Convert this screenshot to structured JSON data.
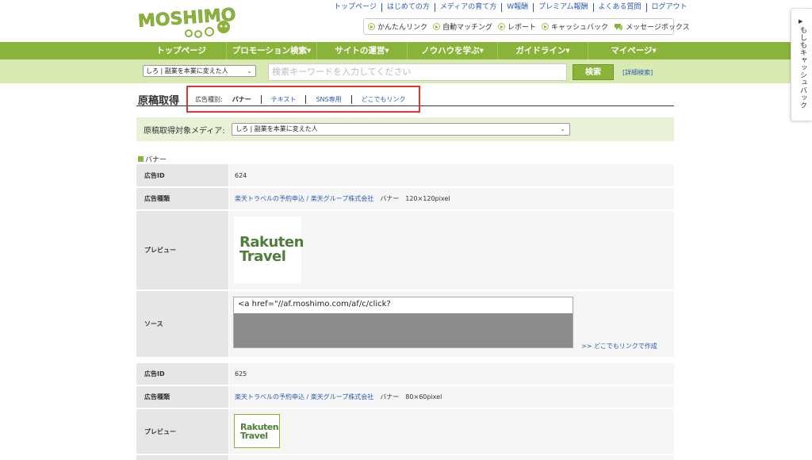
{
  "header": {
    "logo_text": "MOSHIMO",
    "top_links": [
      "トップページ",
      "はじめての方",
      "メディアの育て方",
      "W報酬",
      "プレミアム報酬",
      "よくある質問",
      "ログアウト"
    ],
    "quick_links": [
      "かんたんリンク",
      "自動マッチング",
      "レポート",
      "キャッシュバック",
      "メッセージボックス"
    ]
  },
  "nav": {
    "items": [
      "トップページ",
      "プロモーション検索▾",
      "サイトの運営▾",
      "ノウハウを学ぶ▾",
      "ガイドライン▾",
      "マイページ▾"
    ]
  },
  "search": {
    "media_select": "しろ | 副業を本業に変えた人",
    "placeholder": "検索キーワードを入力してください",
    "button": "検索",
    "advanced": "[詳細検索]"
  },
  "page": {
    "title": "原稿取得",
    "ad_type_label": "広告種別:",
    "tabs": [
      "バナー",
      "テキスト",
      "SNS専用",
      "どこでもリンク"
    ],
    "media_label": "原稿取得対象メディア:",
    "media_value": "しろ | 副業を本業に変えた人",
    "section": "バナー"
  },
  "labels": {
    "ad_id": "広告ID",
    "ad_type": "広告種類",
    "preview": "プレビュー",
    "source": "ソース"
  },
  "ads": [
    {
      "id": "624",
      "product_link": "楽天トラベルの予約申込 / 楽天グループ株式会社",
      "size_text": "バナー　120×120pixel",
      "preview_line1": "Rakuten",
      "preview_line2": "Travel",
      "source_text": "<a href=\"//af.moshimo.com/af/c/click?",
      "make_link": ">> どこでもリンクで作成"
    },
    {
      "id": "625",
      "product_link": "楽天トラベルの予約申込 / 楽天グループ株式会社",
      "size_text": "バナー　80×60pixel",
      "preview_line1": "Rakuten",
      "preview_line2": "Travel"
    }
  ],
  "side_tab": {
    "arrow": "▶",
    "text": "もしもキャッシュバック"
  },
  "colors": {
    "brand_green": "#8ab33a",
    "light_green": "#d8eab1",
    "link_blue": "#2a5bb5",
    "highlight_red": "#e1352d"
  }
}
